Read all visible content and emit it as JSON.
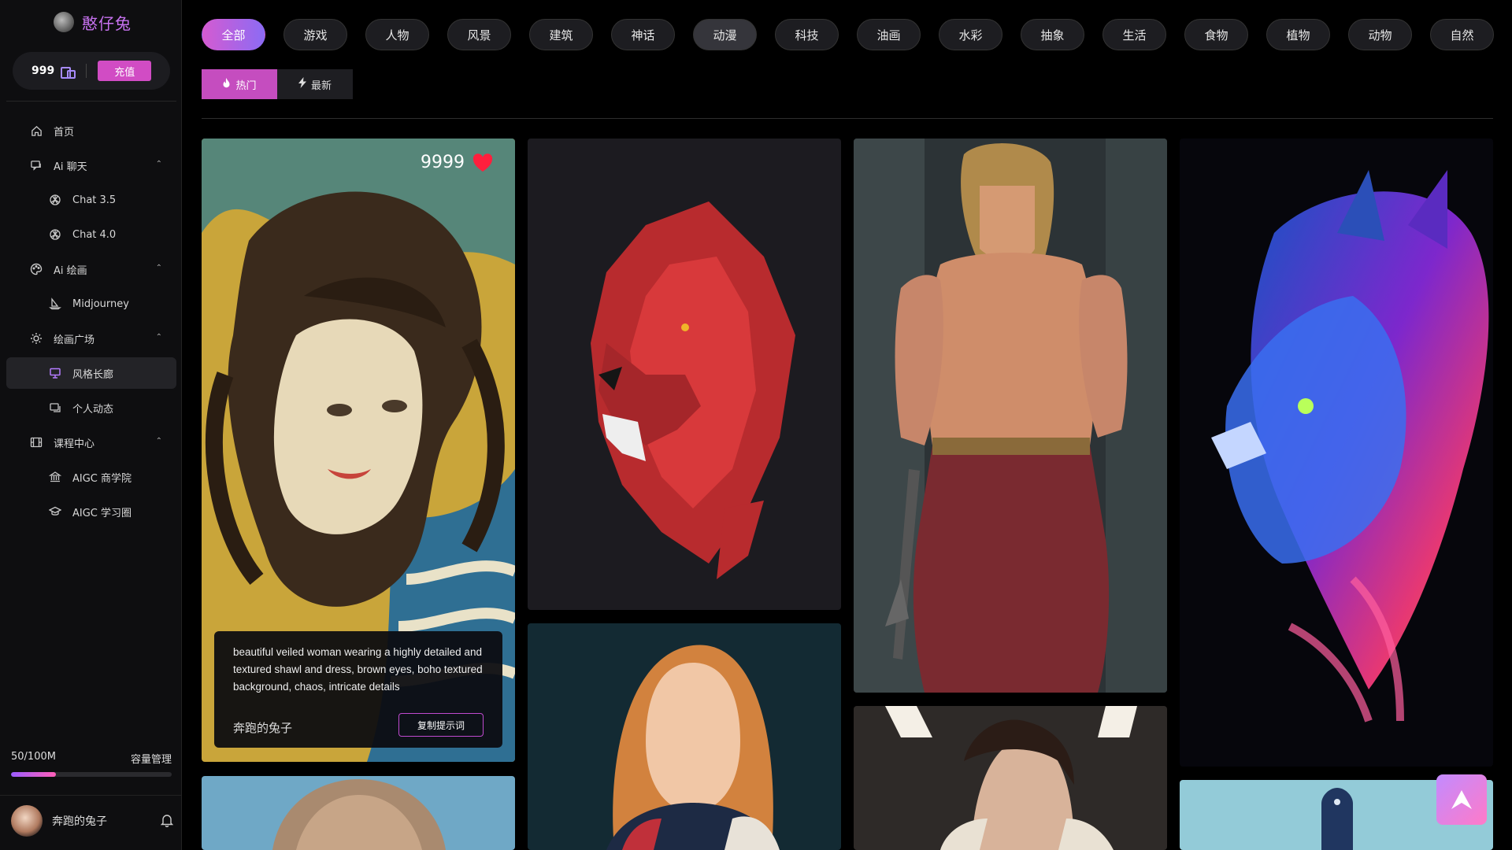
{
  "brand": {
    "name": "憨仔兔"
  },
  "credits": {
    "amount": "999",
    "recharge_label": "充值"
  },
  "nav": {
    "home": "首页",
    "ai_chat": "Ai 聊天",
    "chat35": "Chat 3.5",
    "chat40": "Chat 4.0",
    "ai_draw": "Ai 绘画",
    "midjourney": "Midjourney",
    "square": "绘画广场",
    "gallery": "风格长廊",
    "personal": "个人动态",
    "courses": "课程中心",
    "aigc_business": "AIGC 商学院",
    "aigc_learning": "AIGC 学习圈"
  },
  "storage": {
    "usage": "50/100M",
    "manage_label": "容量管理",
    "fraction": 0.5
  },
  "user": {
    "name": "奔跑的兔子"
  },
  "categories": [
    "全部",
    "游戏",
    "人物",
    "风景",
    "建筑",
    "神话",
    "动漫",
    "科技",
    "油画",
    "水彩",
    "抽象",
    "生活",
    "食物",
    "植物",
    "动物",
    "自然"
  ],
  "sort": {
    "hot": "热门",
    "latest": "最新"
  },
  "featured": {
    "likes": "9999",
    "prompt": "beautiful veiled woman wearing a highly detailed and textured shawl and dress, brown eyes, boho textured background, chaos, intricate details",
    "author": "奔跑的兔子",
    "copy_label": "复制提示词"
  },
  "colors": {
    "accent": "#c54dbf",
    "brand": "#c772f0",
    "heart": "#ff1f3d"
  }
}
